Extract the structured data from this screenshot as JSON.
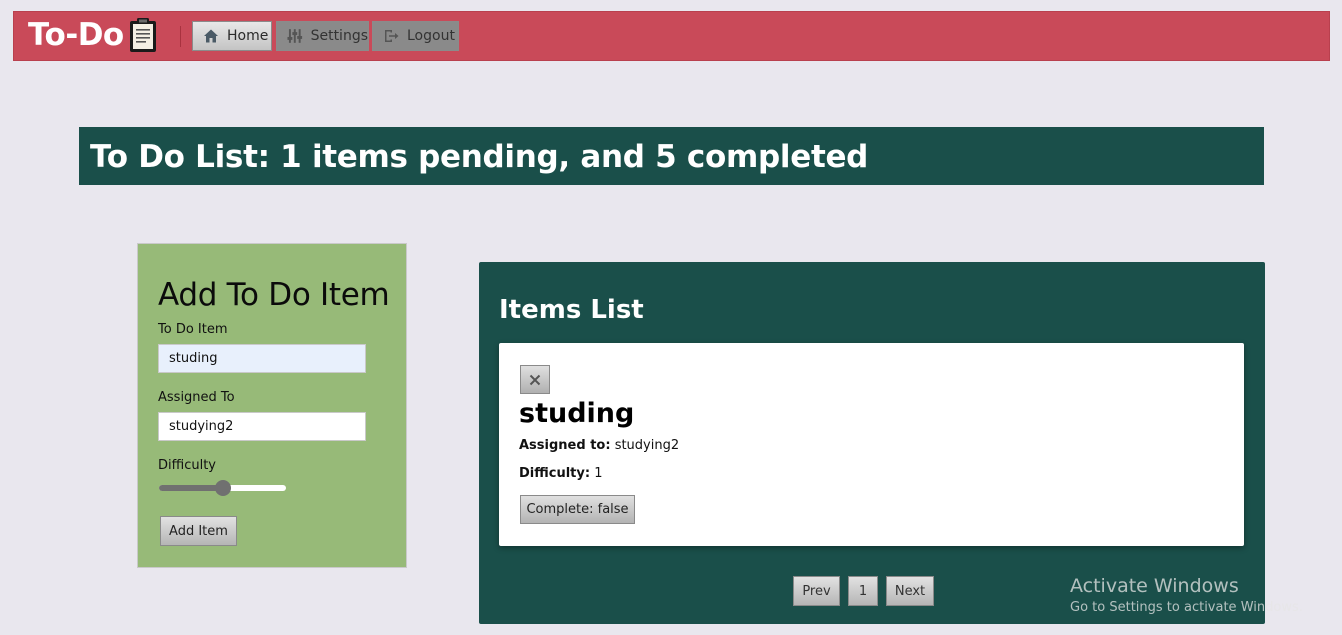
{
  "navbar": {
    "brand": "To-Do",
    "brand_icon": "clipboard-icon",
    "accent": "#c94a59",
    "buttons": [
      {
        "label": "Home",
        "icon": "home-icon"
      },
      {
        "label": "Settings",
        "icon": "sliders-icon"
      },
      {
        "label": "Logout",
        "icon": "logout-icon"
      }
    ]
  },
  "banner": {
    "title": "To Do List: 1 items pending, and 5 completed",
    "color": "#1a4f4a"
  },
  "form": {
    "title": "Add To Do Item",
    "item_label": "To Do Item",
    "item_value": "studing",
    "assigned_label": "Assigned To",
    "assigned_value": "studying2",
    "difficulty_label": "Difficulty",
    "difficulty_value": 0.5,
    "submit_label": "Add Item",
    "color": "#97ba78"
  },
  "list": {
    "title": "Items List",
    "items": [
      {
        "title": "studing",
        "assigned_label": "Assigned to:",
        "assigned_value": "studying2",
        "difficulty_label": "Difficulty:",
        "difficulty_value": "1",
        "complete_label": "Complete: false"
      }
    ],
    "pagination": {
      "prev": "Prev",
      "page": "1",
      "next": "Next"
    }
  },
  "watermark": {
    "line1": "Activate Windows",
    "line2": "Go to Settings to activate Windows."
  }
}
